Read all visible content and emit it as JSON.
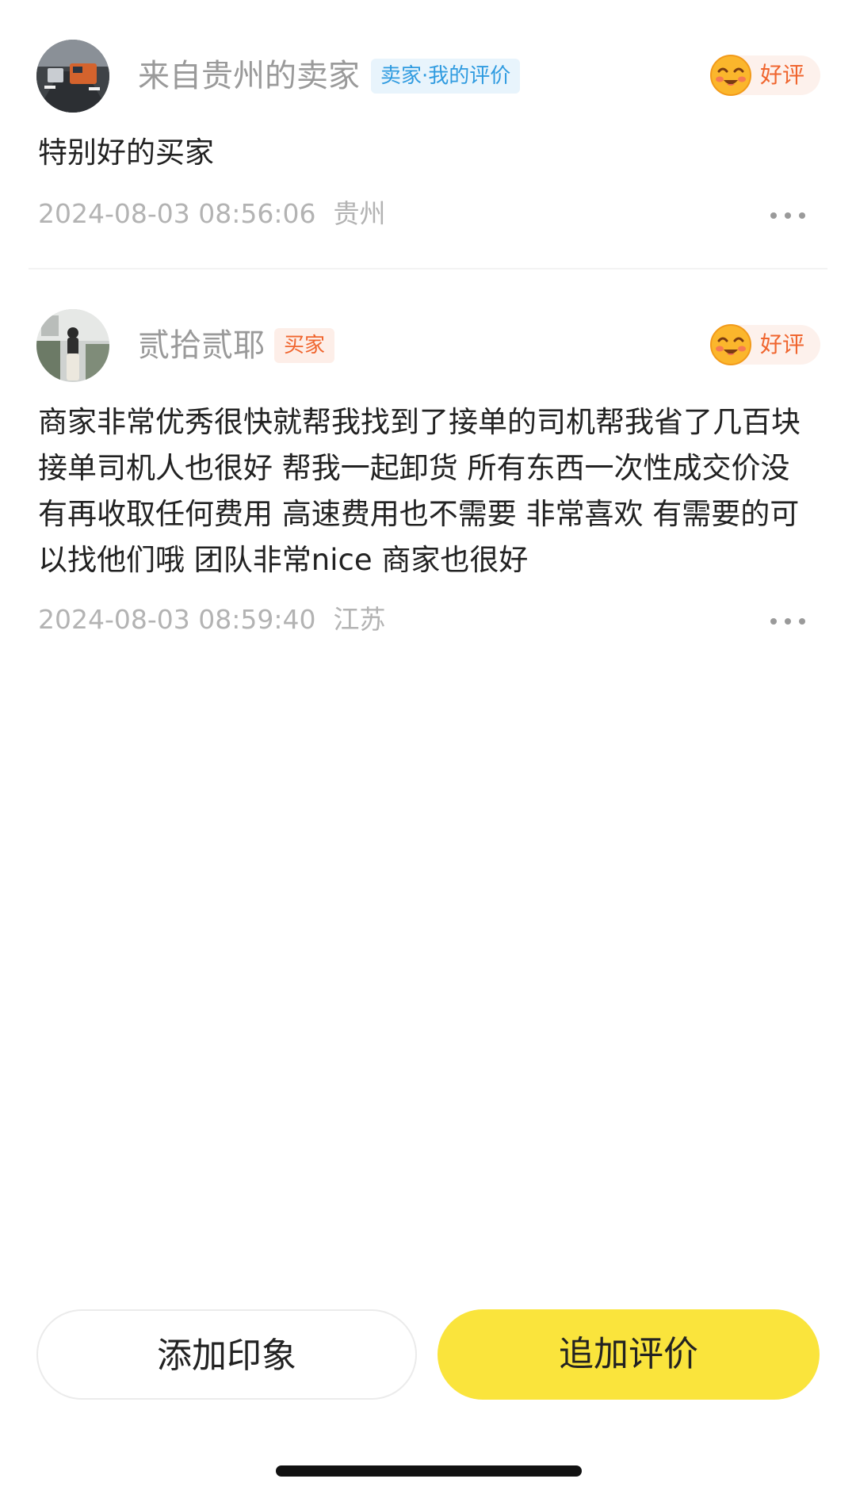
{
  "reviews": [
    {
      "username": "来自贵州的卖家",
      "tag": "卖家·我的评价",
      "rating": "好评",
      "content": "特别好的买家",
      "timestamp": "2024-08-03 08:56:06",
      "location": "贵州"
    },
    {
      "username": "贰拾贰耶",
      "tag": "买家",
      "rating": "好评",
      "content": "商家非常优秀很快就帮我找到了接单的司机帮我省了几百块 接单司机人也很好 帮我一起卸货 所有东西一次性成交价没有再收取任何费用 高速费用也不需要 非常喜欢 有需要的可以找他们哦 团队非常nice 商家也很好",
      "timestamp": "2024-08-03 08:59:40",
      "location": "江苏"
    }
  ],
  "actions": {
    "add_impression": "添加印象",
    "follow_up_review": "追加评价"
  },
  "colors": {
    "accent_yellow": "#fae43c",
    "seller_tag": "#2f9be0",
    "buyer_tag": "#f0652e",
    "rating_orange": "#f0652e",
    "muted_text": "#b3b3b3"
  },
  "icons": {
    "rating": "smiling-face-icon",
    "more": "more-dots-icon"
  }
}
